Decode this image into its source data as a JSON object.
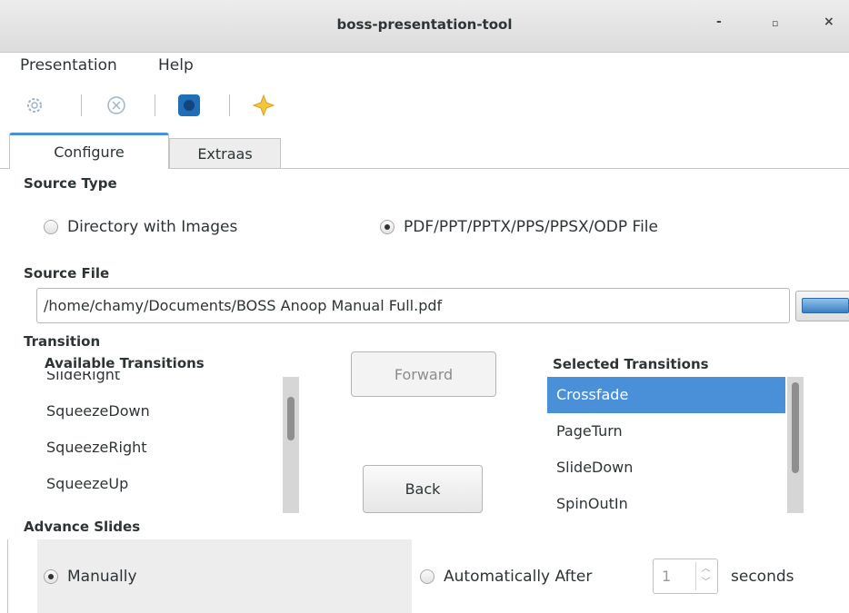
{
  "window": {
    "title": "boss-presentation-tool",
    "controls": {
      "minimize": "-",
      "maximize": "▫",
      "close": "×"
    }
  },
  "menu": {
    "items": [
      "Presentation",
      "Help"
    ]
  },
  "toolbar": {
    "icons": [
      "gear-icon",
      "cancel-circle-icon",
      "help-icon",
      "star-icon"
    ]
  },
  "tabs": [
    {
      "label": "Configure",
      "active": true
    },
    {
      "label": "Extraas",
      "active": false
    }
  ],
  "source_type": {
    "label": "Source Type",
    "options": [
      {
        "label": "Directory with Images",
        "checked": false
      },
      {
        "label": "PDF/PPT/PPTX/PPS/PPSX/ODP File",
        "checked": true
      }
    ]
  },
  "source_file": {
    "label": "Source File",
    "value": "/home/chamy/Documents/BOSS Anoop Manual Full.pdf"
  },
  "transition": {
    "label": "Transition",
    "available_label": "Available Transitions",
    "available_partial": "SlideRight",
    "available": [
      "SqueezeDown",
      "SqueezeRight",
      "SqueezeUp"
    ],
    "selected_label": "Selected Transitions",
    "selected": [
      "Crossfade",
      "PageTurn",
      "SlideDown",
      "SpinOutIn"
    ],
    "forward_label": "Forward",
    "back_label": "Back"
  },
  "advance": {
    "label": "Advance Slides",
    "manual_label": "Manually",
    "auto_label": "Automatically After",
    "seconds_value": "1",
    "seconds_label": "seconds"
  },
  "colors": {
    "selection": "#4a90d9",
    "help_icon": "#1f6fb8",
    "star_icon": "#f5c542"
  }
}
